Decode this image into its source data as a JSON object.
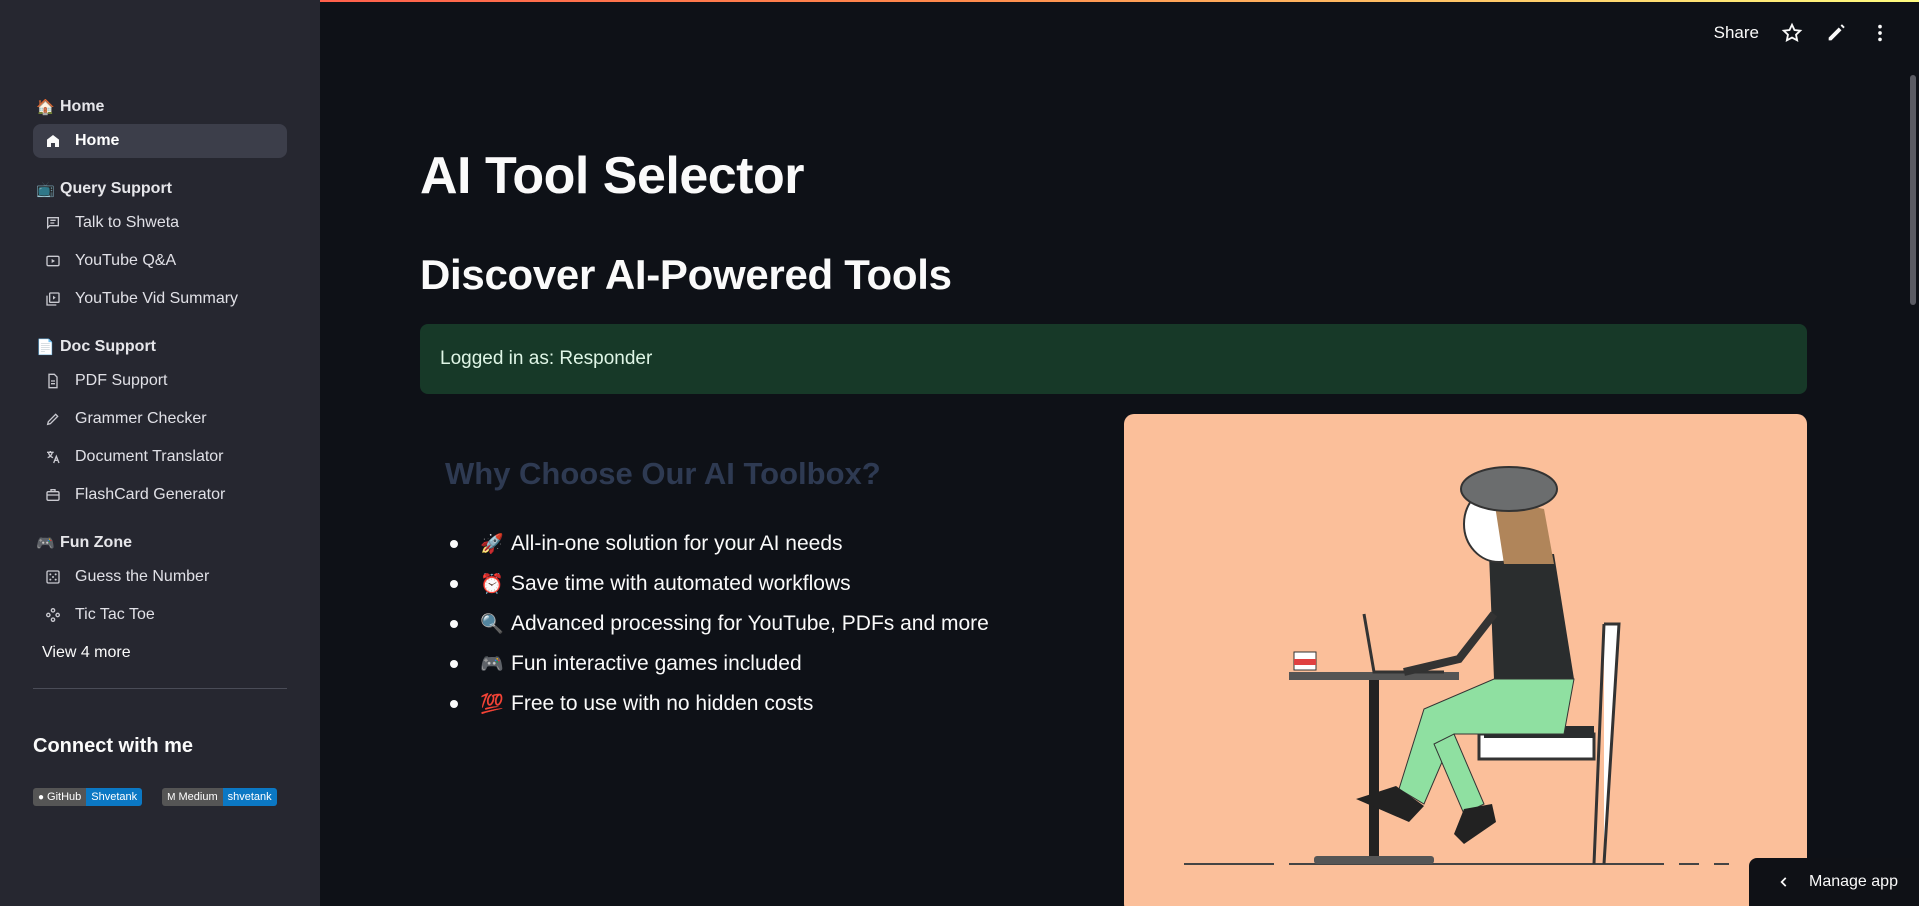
{
  "sidebar": {
    "sections": [
      {
        "emoji": "🏠",
        "title": "Home",
        "items": [
          {
            "label": "Home",
            "icon": "home-icon",
            "active": true
          }
        ]
      },
      {
        "emoji": "📺",
        "title": "Query Support",
        "items": [
          {
            "label": "Talk to Shweta",
            "icon": "chat-icon"
          },
          {
            "label": "YouTube Q&A",
            "icon": "play-box-icon"
          },
          {
            "label": "YouTube Vid Summary",
            "icon": "video-library-icon"
          }
        ]
      },
      {
        "emoji": "📄",
        "title": "Doc Support",
        "items": [
          {
            "label": "PDF Support",
            "icon": "document-icon"
          },
          {
            "label": "Grammer Checker",
            "icon": "pencil-icon"
          },
          {
            "label": "Document Translator",
            "icon": "translate-icon"
          },
          {
            "label": "FlashCard Generator",
            "icon": "briefcase-icon"
          }
        ]
      },
      {
        "emoji": "🎮",
        "title": "Fun Zone",
        "items": [
          {
            "label": "Guess the Number",
            "icon": "dice-icon"
          },
          {
            "label": "Tic Tac Toe",
            "icon": "gamepad-icon"
          }
        ]
      }
    ],
    "view_more": "View 4 more",
    "connect_title": "Connect with me",
    "badges": [
      {
        "left": "GitHub",
        "right": "Shvetank",
        "icon": "github-icon"
      },
      {
        "left": "Medium",
        "right": "shvetank",
        "icon": "medium-icon"
      }
    ]
  },
  "toolbar": {
    "share": "Share"
  },
  "main": {
    "title": "AI Tool Selector",
    "subtitle": "Discover AI-Powered Tools",
    "logged_in": "Logged in as: Responder",
    "why_title": "Why Choose Our AI Toolbox?",
    "features": [
      {
        "emoji": "🚀",
        "text": "All-in-one solution for your AI needs"
      },
      {
        "emoji": "⏰",
        "text": "Save time with automated workflows"
      },
      {
        "emoji": "🔍",
        "text": "Advanced processing for YouTube, PDFs and more"
      },
      {
        "emoji": "🎮",
        "text": "Fun interactive games included"
      },
      {
        "emoji": "💯",
        "text": "Free to use with no hidden costs"
      }
    ]
  },
  "manage_app": "Manage app",
  "colors": {
    "accent_success_bg": "#173928",
    "illustration_bg": "#fbbf9a",
    "sidebar_bg": "#262730",
    "main_bg": "#0e1117"
  }
}
